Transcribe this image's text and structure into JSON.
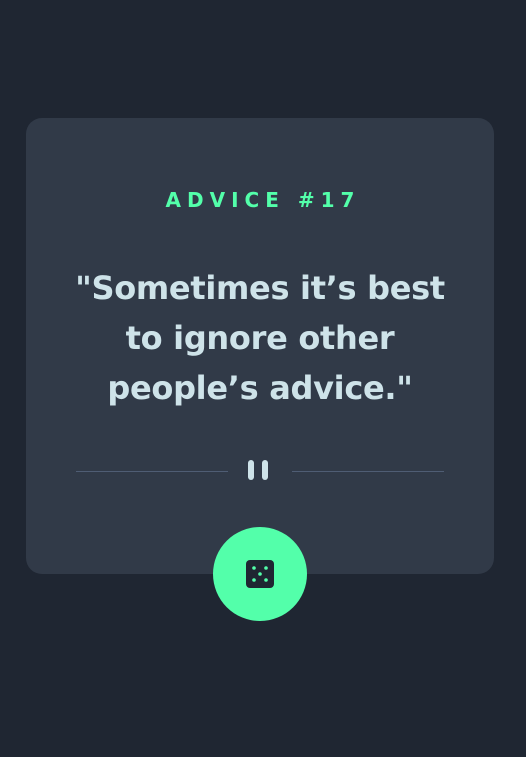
{
  "card": {
    "advice_label": "ADVICE #17",
    "quote": "\"Sometimes it’s best to ignore other people’s advice.\""
  },
  "colors": {
    "background": "#1f2632",
    "card": "#313a48",
    "accent": "#53ffaa",
    "text": "#cee3e9",
    "divider": "#4f5d74"
  },
  "icons": {
    "divider": "pause-icon",
    "button": "dice-icon"
  }
}
